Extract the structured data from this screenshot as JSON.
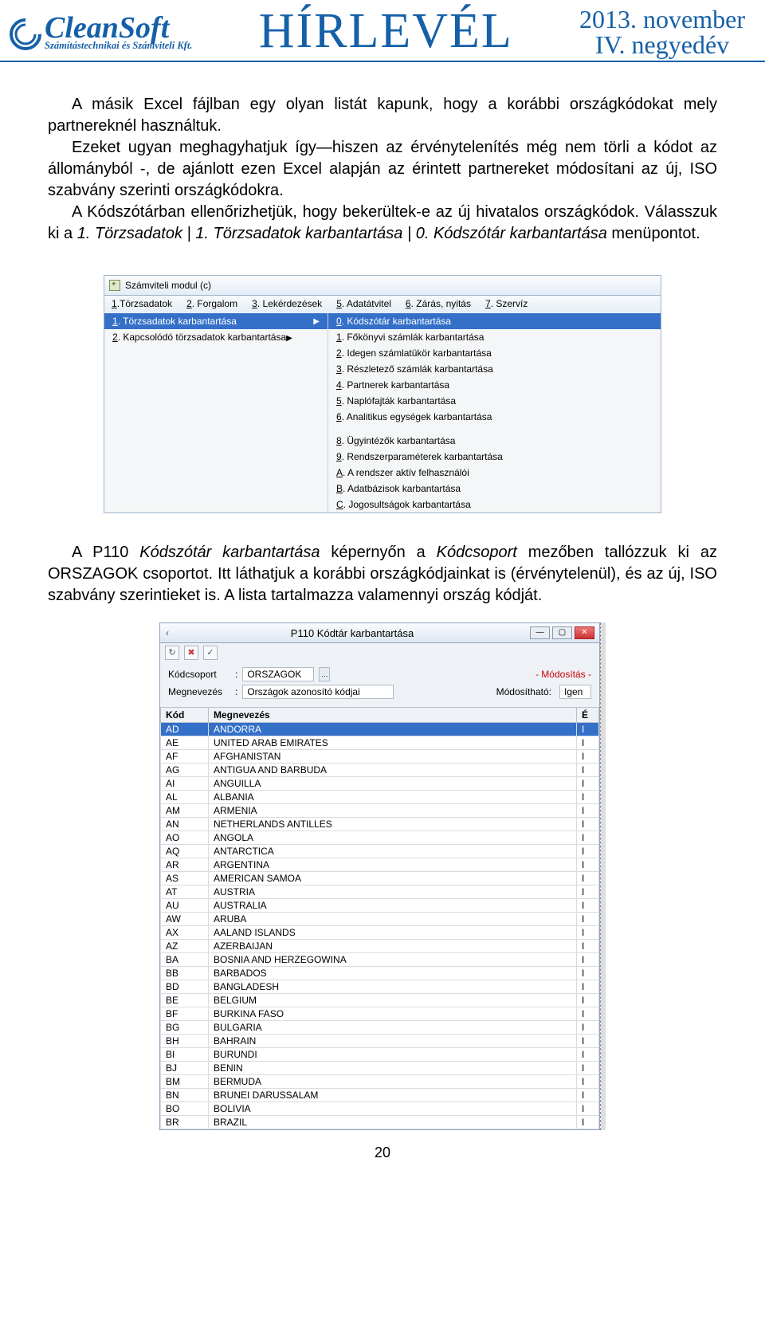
{
  "header": {
    "logo_main": "CleanSoft",
    "logo_sub": "Számítástechnikai és Számviteli Kft.",
    "center": "HÍRLEVÉL",
    "date_line1": "2013. november",
    "date_line2": "IV. negyedév"
  },
  "para1_a": "A másik Excel fájlban egy olyan listát kapunk, hogy a korábbi országkódokat mely partnereknél használtuk.",
  "para1_b": "Ezeket ugyan meghagyhatjuk így—hiszen az érvénytelenítés még nem törli a kódot az állományból -, de ajánlott ezen Excel alapján az érintett partnereket módosítani az új, ISO szabvány szerinti országkódokra.",
  "para1_c_pre": "A Kódszótárban ellenőrizhetjük, hogy bekerültek-e az új hivatalos országkódok. Válasszuk ki a ",
  "para1_c_i1": "1. Törzsadatok | 1. Törzsadatok karbantartása | 0. Kódszótár karbantartása",
  "para1_c_post": " menüpontot.",
  "ss1": {
    "title": "Számviteli modul (c)",
    "menubar": [
      {
        "u": "1",
        "rest": ".Törzsadatok"
      },
      {
        "u": "2",
        "rest": ". Forgalom"
      },
      {
        "u": "3",
        "rest": ". Lekérdezések"
      },
      {
        "u": "5",
        "rest": ". Adatátvitel"
      },
      {
        "u": "6",
        "rest": ". Zárás, nyitás"
      },
      {
        "u": "7",
        "rest": ". Szervíz"
      }
    ],
    "left": [
      {
        "u": "1",
        "label": ". Törzsadatok karbantartása",
        "sel": true,
        "arrow": true
      },
      {
        "u": "2",
        "label": ". Kapcsolódó törzsadatok karbantartása",
        "sel": false,
        "arrow": true
      }
    ],
    "right": [
      {
        "u": "0",
        "label": ". Kódszótár karbantartása",
        "sel": true
      },
      {
        "u": "1",
        "label": ". Főkönyvi számlák karbantartása"
      },
      {
        "u": "2",
        "label": ". Idegen számlatükör karbantartása"
      },
      {
        "u": "3",
        "label": ". Részletező számlák karbantartása"
      },
      {
        "u": "4",
        "label": ". Partnerek karbantartása"
      },
      {
        "u": "5",
        "label": ". Naplófajták karbantartása"
      },
      {
        "u": "6",
        "label": ". Analitikus egységek karbantartása"
      },
      {
        "gap": true
      },
      {
        "u": "8",
        "label": ". Ügyintézők karbantartása"
      },
      {
        "u": "9",
        "label": ". Rendszerparaméterek karbantartása"
      },
      {
        "u": "A",
        "label": ". A rendszer aktív felhasználói"
      },
      {
        "u": "B",
        "label": ". Adatbázisok karbantartása"
      },
      {
        "u": "C",
        "label": ". Jogosultságok karbantartása"
      }
    ]
  },
  "para2_pre": "A P110 ",
  "para2_i1": "Kódszótár karbantartása",
  "para2_mid": " képernyőn a ",
  "para2_i2": "Kódcsoport",
  "para2_post": " mezőben tallózzuk ki az ORSZAGOK csoportot. Itt láthatjuk a korábbi országkódjainkat is (érvénytelenül), és az új, ISO szabvány szerintieket is. A lista tartalmazza valamennyi ország kódját.",
  "ss2": {
    "title": "P110 Kódtár karbantartása",
    "mod_label": "- Módosítás -",
    "form": {
      "l1": "Kódcsoport",
      "v1": "ORSZAGOK",
      "l2": "Megnevezés",
      "v2": "Országok azonosító kódjai",
      "l3": "Módosítható:",
      "v3": "Igen"
    },
    "cols": [
      "Kód",
      "Megnevezés",
      "É"
    ],
    "rows": [
      {
        "k": "AD",
        "m": "ANDORRA",
        "e": "I",
        "sel": true
      },
      {
        "k": "AE",
        "m": "UNITED ARAB EMIRATES",
        "e": "I"
      },
      {
        "k": "AF",
        "m": "AFGHANISTAN",
        "e": "I"
      },
      {
        "k": "AG",
        "m": "ANTIGUA AND BARBUDA",
        "e": "I"
      },
      {
        "k": "AI",
        "m": "ANGUILLA",
        "e": "I"
      },
      {
        "k": "AL",
        "m": "ALBANIA",
        "e": "I"
      },
      {
        "k": "AM",
        "m": "ARMENIA",
        "e": "I"
      },
      {
        "k": "AN",
        "m": "NETHERLANDS ANTILLES",
        "e": "I"
      },
      {
        "k": "AO",
        "m": "ANGOLA",
        "e": "I"
      },
      {
        "k": "AQ",
        "m": "ANTARCTICA",
        "e": "I"
      },
      {
        "k": "AR",
        "m": "ARGENTINA",
        "e": "I"
      },
      {
        "k": "AS",
        "m": "AMERICAN SAMOA",
        "e": "I"
      },
      {
        "k": "AT",
        "m": "AUSTRIA",
        "e": "I"
      },
      {
        "k": "AU",
        "m": "AUSTRALIA",
        "e": "I"
      },
      {
        "k": "AW",
        "m": "ARUBA",
        "e": "I"
      },
      {
        "k": "AX",
        "m": "AALAND ISLANDS",
        "e": "I"
      },
      {
        "k": "AZ",
        "m": "AZERBAIJAN",
        "e": "I"
      },
      {
        "k": "BA",
        "m": "BOSNIA AND HERZEGOWINA",
        "e": "I"
      },
      {
        "k": "BB",
        "m": "BARBADOS",
        "e": "I"
      },
      {
        "k": "BD",
        "m": "BANGLADESH",
        "e": "I"
      },
      {
        "k": "BE",
        "m": "BELGIUM",
        "e": "I"
      },
      {
        "k": "BF",
        "m": "BURKINA FASO",
        "e": "I"
      },
      {
        "k": "BG",
        "m": "BULGARIA",
        "e": "I"
      },
      {
        "k": "BH",
        "m": "BAHRAIN",
        "e": "I"
      },
      {
        "k": "BI",
        "m": "BURUNDI",
        "e": "I"
      },
      {
        "k": "BJ",
        "m": "BENIN",
        "e": "I"
      },
      {
        "k": "BM",
        "m": "BERMUDA",
        "e": "I"
      },
      {
        "k": "BN",
        "m": "BRUNEI DARUSSALAM",
        "e": "I"
      },
      {
        "k": "BO",
        "m": "BOLIVIA",
        "e": "I"
      },
      {
        "k": "BR",
        "m": "BRAZIL",
        "e": "I"
      }
    ]
  },
  "page_num": "20"
}
